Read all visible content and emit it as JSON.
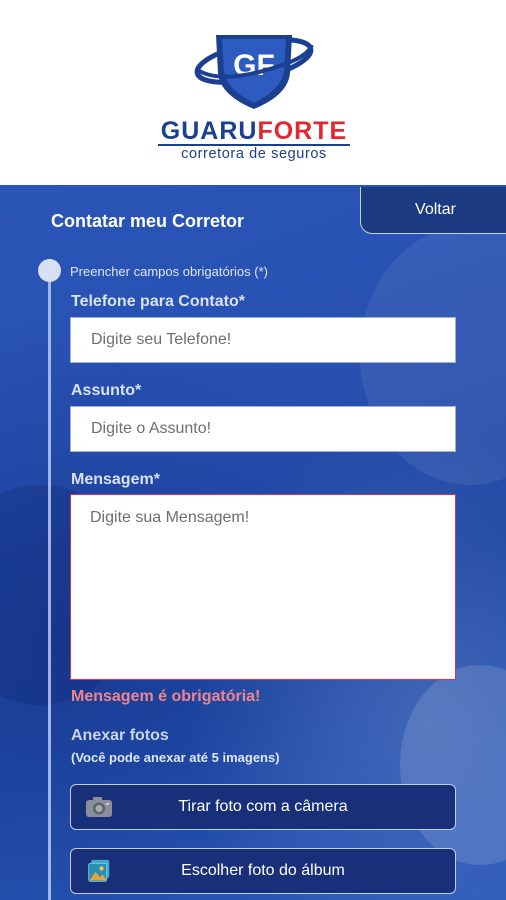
{
  "header": {
    "brand_part1": "GUARU",
    "brand_part2": "FORTE",
    "brand_subtitle": "corretora de seguros",
    "logo_letters": "GF",
    "colors": {
      "brand_blue": "#1b3f91",
      "brand_red": "#e3262f"
    }
  },
  "page": {
    "title": "Contatar meu Corretor",
    "back_label": "Voltar",
    "required_note": "Preencher campos obrigatórios (*)"
  },
  "form": {
    "phone": {
      "label": "Telefone para Contato*",
      "placeholder": "Digite seu Telefone!",
      "value": ""
    },
    "subject": {
      "label": "Assunto*",
      "placeholder": "Digite o Assunto!",
      "value": ""
    },
    "message": {
      "label": "Mensagem*",
      "placeholder": "Digite sua Mensagem!",
      "value": "",
      "error": "Mensagem é obrigatória!"
    }
  },
  "attachments": {
    "title": "Anexar fotos",
    "subtitle": "(Você pode anexar até 5 imagens)",
    "camera_button": {
      "label": "Tirar foto com a câmera",
      "icon": "camera-icon"
    },
    "album_button": {
      "label": "Escolher foto do álbum",
      "icon": "photo-album-icon"
    }
  }
}
